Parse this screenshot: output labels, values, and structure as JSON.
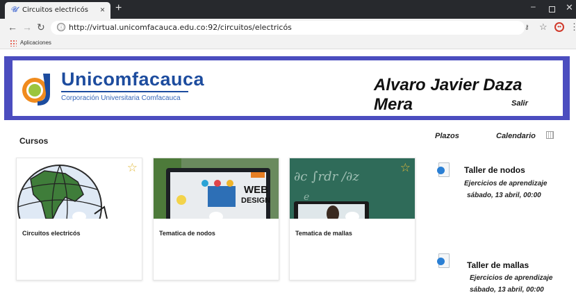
{
  "browser": {
    "tab_title": "Circuitos electricós",
    "tab_close": "×",
    "new_tab": "+",
    "url_scheme_icon": "ⓘ",
    "url": "http://virtual.unicomfacauca.edu.co:92/circuitos/electricós",
    "bookmark_apps": "Aplicaciones",
    "favicon": "𝒰",
    "window_buttons": {
      "minimize": "–",
      "close": "✕"
    }
  },
  "header": {
    "logo_name": "Unicomfacauca",
    "logo_subtitle": "Corporación Universitaria Comfacauca",
    "user_name": "Alvaro Javier Daza Mera",
    "logout_label": "Salir"
  },
  "courses": {
    "title": "Cursos",
    "items": [
      {
        "name": "Circuitos electricós",
        "star": "☆"
      },
      {
        "name": "Tematica de nodos",
        "star": ""
      },
      {
        "name": "Tematica de mallas",
        "star": "☆"
      }
    ]
  },
  "sidebar": {
    "deadlines_label": "Plazos",
    "calendar_label": "Calendario",
    "events": [
      {
        "title": "Taller de nodos",
        "type": "Ejercicios de aprendizaje",
        "date": "sábado, 13 abril, 00:00"
      },
      {
        "title": "Taller de mallas",
        "type": "Ejercicios de aprendizaje",
        "date": "sábado, 13 abril, 00:00"
      }
    ]
  },
  "colors": {
    "brand_blue": "#1d4c9e",
    "banner_border": "#4b4dbf",
    "star": "#e2b93b"
  }
}
